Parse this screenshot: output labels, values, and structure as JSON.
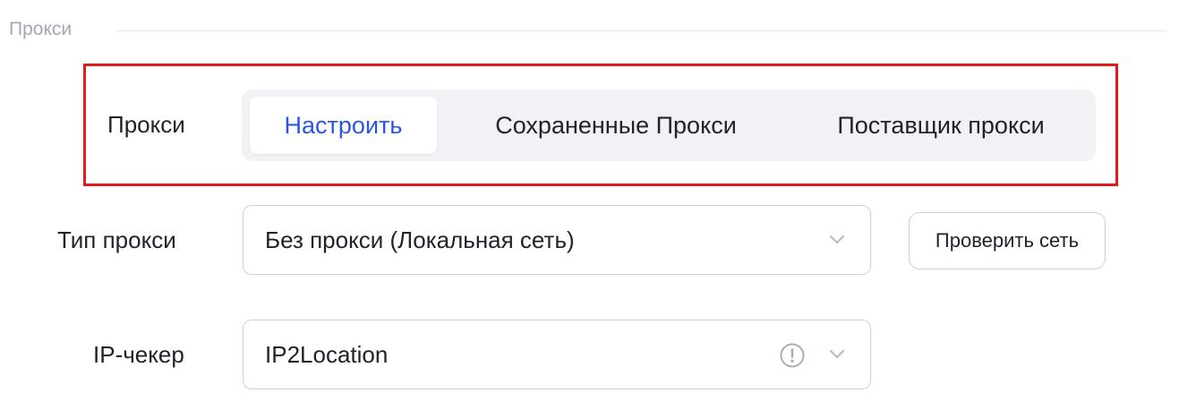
{
  "section": {
    "title": "Прокси"
  },
  "proxy_mode": {
    "label": "Прокси",
    "tabs": [
      {
        "label": "Настроить",
        "active": true
      },
      {
        "label": "Сохраненные Прокси",
        "active": false
      },
      {
        "label": "Поставщик прокси",
        "active": false
      }
    ]
  },
  "proxy_type": {
    "label": "Тип прокси",
    "value": "Без прокси (Локальная сеть)",
    "check_button": "Проверить сеть"
  },
  "ip_checker": {
    "label": "IP-чекер",
    "value": "IP2Location"
  },
  "colors": {
    "accent": "#2a56e6",
    "highlight_border": "#e01b1b",
    "segment_bg": "#f1f2f5",
    "border": "#cdd1d7"
  }
}
